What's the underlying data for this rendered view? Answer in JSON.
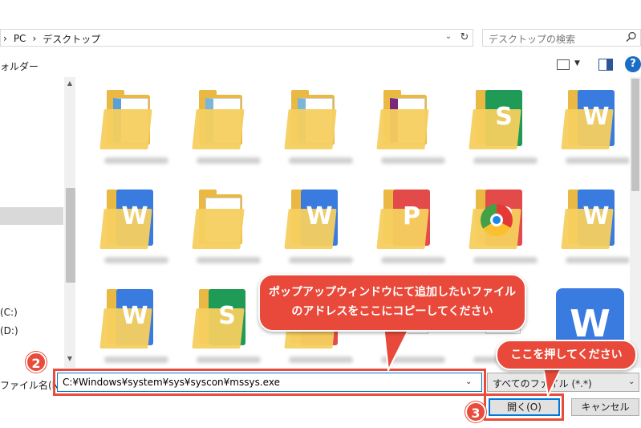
{
  "address": {
    "crumbs": [
      "PC",
      "デスクトップ"
    ],
    "separator": "›",
    "search_placeholder": "デスクトップの検索"
  },
  "toolbar": {
    "folder_label": "ォルダー",
    "help_label": "?"
  },
  "nav": {
    "drive_c": "(C:)",
    "drive_d": "(D:)"
  },
  "file_name": {
    "label": "ファイル名(N):",
    "value": "C:¥Windows¥system¥sys¥syscon¥mssys.exe"
  },
  "file_type": {
    "selected": "すべてのファイル (*.*)"
  },
  "buttons": {
    "open": "開く(O)",
    "cancel": "キャンセル"
  },
  "annotations": {
    "bubble1_line1": "ポップアップウィンドウにて追加したいファイル",
    "bubble1_line2": "のアドレスをここにコピーしてください",
    "bubble2": "ここを押してください",
    "step2": "2",
    "step3": "3"
  },
  "colors": {
    "accent": "#0078d7",
    "annotation_red": "#e74c3c",
    "folder_yellow": "#e9b943"
  },
  "icons": [
    "search-icon",
    "refresh-icon",
    "chevron-down-icon",
    "view-icon",
    "preview-pane-icon",
    "help-icon"
  ],
  "tiles": [
    {
      "kind": "folder",
      "accent": "#5aa0d8"
    },
    {
      "kind": "folder",
      "accent": "#7ab6d8"
    },
    {
      "kind": "folder",
      "accent": "#7ab6d8"
    },
    {
      "kind": "folder",
      "accent": "#7b2a7a"
    },
    {
      "kind": "folder",
      "accent": "#1f9b57"
    },
    {
      "kind": "folder",
      "accent": "#3a7be0"
    },
    {
      "kind": "folder",
      "accent": "#3a7be0"
    },
    {
      "kind": "folder",
      "accent": "#e0e0e0"
    },
    {
      "kind": "folder",
      "accent": "#3a7be0"
    },
    {
      "kind": "folder",
      "accent": "#e34b4b"
    },
    {
      "kind": "folder",
      "accent": "#e34b4b"
    },
    {
      "kind": "folder",
      "accent": "#3a7be0"
    },
    {
      "kind": "folder",
      "accent": "#3a7be0"
    },
    {
      "kind": "folder",
      "accent": "#1f9b57"
    },
    {
      "kind": "folder",
      "accent": "#e34b4b"
    },
    {
      "kind": "doc",
      "accent": "#ffffff"
    },
    {
      "kind": "doc",
      "accent": "#ffffff"
    }
  ]
}
